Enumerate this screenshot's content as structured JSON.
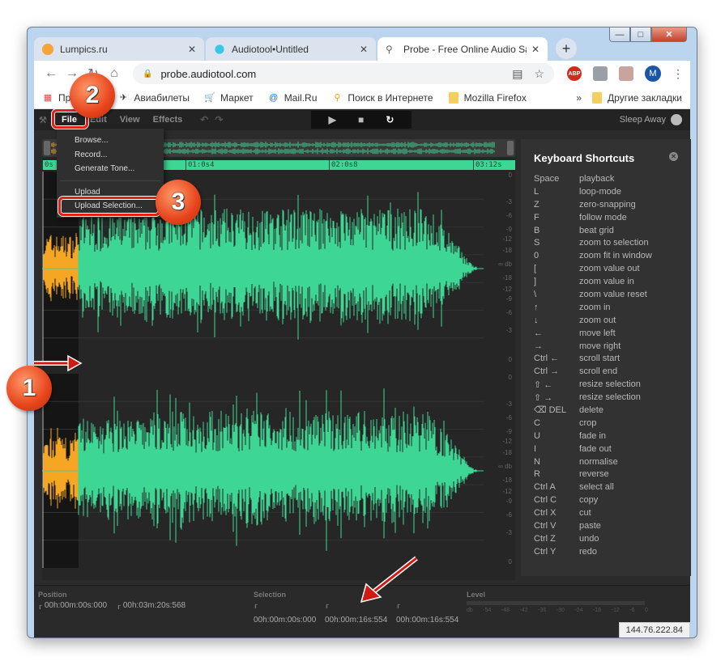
{
  "browser": {
    "tabs": [
      {
        "title": "Lumpics.ru",
        "icon": "lumpics-favicon",
        "active": false
      },
      {
        "title": "Audiotool•Untitled",
        "icon": "audiotool-favicon",
        "active": false
      },
      {
        "title": "Probe - Free Online Audio Sampl",
        "icon": "probe-favicon",
        "active": true
      }
    ],
    "new_tab": "+",
    "url": "probe.audiotool.com",
    "profile_initial": "M",
    "extensions": [
      "translate-icon",
      "star-icon",
      "adblock-icon",
      "extension-icon",
      "pdf-icon"
    ],
    "adblock_label": "ABP",
    "bookmarks": [
      {
        "label": "Пр",
        "icon": "apps-icon"
      },
      {
        "label": "Авиабилеты",
        "icon": "plane-icon"
      },
      {
        "label": "Маркет",
        "icon": "cart-icon"
      },
      {
        "label": "Mail.Ru",
        "icon": "mailru-icon"
      },
      {
        "label": "Поиск в Интернете",
        "icon": "search-icon"
      },
      {
        "label": "Mozilla Firefox",
        "icon": "folder-icon"
      }
    ],
    "bookmarks_overflow": "»",
    "other_bookmarks": "Другие закладки"
  },
  "app": {
    "menu": [
      "File",
      "Edit",
      "View",
      "Effects"
    ],
    "track_name": "Sleep Away",
    "file_menu": {
      "items": [
        "Browse...",
        "Record...",
        "Generate Tone...",
        "Upload",
        "Upload Selection..."
      ]
    },
    "timeline_marks": [
      "0s",
      "01:0s4",
      "02:0s8",
      "03:12s"
    ],
    "db_scale": [
      "0",
      "-3",
      "-6",
      "-9",
      "-12",
      "-18",
      "∞ db",
      "-18",
      "-12",
      "-9",
      "-6",
      "-3",
      "0"
    ],
    "shortcuts": {
      "title": "Keyboard Shortcuts",
      "rows": [
        {
          "key": "Space",
          "action": "playback"
        },
        {
          "key": "L",
          "action": "loop-mode"
        },
        {
          "key": "Z",
          "action": "zero-snapping"
        },
        {
          "key": "F",
          "action": "follow mode"
        },
        {
          "key": "B",
          "action": "beat grid"
        },
        {
          "key": "S",
          "action": "zoom to selection"
        },
        {
          "key": "0",
          "action": "zoom fit in window"
        },
        {
          "key": "[",
          "action": "zoom value out"
        },
        {
          "key": "]",
          "action": "zoom value in"
        },
        {
          "key": "\\",
          "action": "zoom value reset"
        },
        {
          "key": "↑",
          "action": "zoom in"
        },
        {
          "key": "↓",
          "action": "zoom out"
        },
        {
          "key": "←",
          "action": "move left"
        },
        {
          "key": "→",
          "action": "move right"
        },
        {
          "key": "Ctrl ←",
          "action": "scroll start"
        },
        {
          "key": "Ctrl →",
          "action": "scroll end"
        },
        {
          "key": "⇧ ←",
          "action": "resize selection"
        },
        {
          "key": "⇧ →",
          "action": "resize selection"
        },
        {
          "key": "⌫ DEL",
          "action": "delete"
        },
        {
          "key": "C",
          "action": "crop"
        },
        {
          "key": "U",
          "action": "fade in"
        },
        {
          "key": "I",
          "action": "fade out"
        },
        {
          "key": "N",
          "action": "normalise"
        },
        {
          "key": "R",
          "action": "reverse"
        },
        {
          "key": "Ctrl A",
          "action": "select all"
        },
        {
          "key": "Ctrl C",
          "action": "copy"
        },
        {
          "key": "Ctrl X",
          "action": "cut"
        },
        {
          "key": "Ctrl V",
          "action": "paste"
        },
        {
          "key": "Ctrl Z",
          "action": "undo"
        },
        {
          "key": "Ctrl Y",
          "action": "redo"
        }
      ]
    },
    "status": {
      "position_label": "Position",
      "position_start": "00h:00m:00s:000",
      "position_end": "00h:03m:20s:568",
      "selection_label": "Selection",
      "selection_start": "00h:00m:00s:000",
      "selection_end": "00h:00m:16s:554",
      "selection_length": "00h:00m:16s:554",
      "level_label": "Level",
      "level_ticks": [
        "db",
        "-54",
        "-48",
        "-42",
        "-36",
        "-30",
        "-24",
        "-18",
        "-12",
        "-6",
        "0"
      ],
      "ip": "144.76.222.84"
    },
    "colors": {
      "waveform": "#3ed694",
      "selection": "#f5a623",
      "background": "#2b2b2b"
    }
  },
  "annotations": {
    "badges": [
      "1",
      "2",
      "3"
    ]
  }
}
